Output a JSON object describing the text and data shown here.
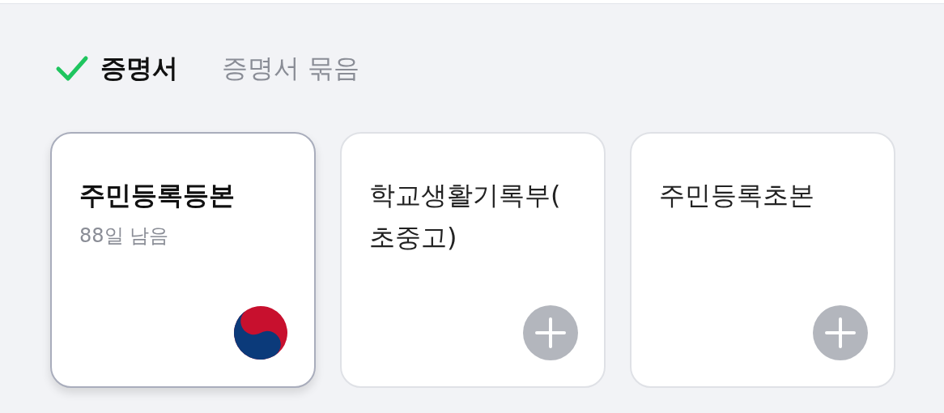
{
  "tabs": [
    {
      "label": "증명서",
      "selected": true
    },
    {
      "label": "증명서 묶음",
      "selected": false
    }
  ],
  "cards": [
    {
      "kind": "issued",
      "title": "주민등록등본",
      "subtitle": "88일 남음",
      "selected": true
    },
    {
      "kind": "add",
      "title": "학교생활기록부(초중고)",
      "selected": false
    },
    {
      "kind": "add",
      "title": "주민등록초본",
      "selected": false
    }
  ]
}
